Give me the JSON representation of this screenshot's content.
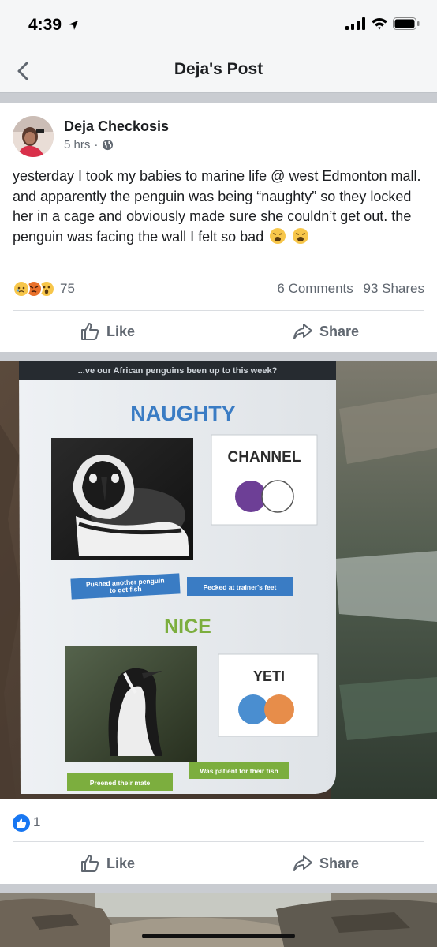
{
  "status_bar": {
    "time": "4:39"
  },
  "nav": {
    "title": "Deja's Post"
  },
  "post": {
    "author": "Deja Checkosis",
    "time": "5 hrs",
    "text": "yesterday I took my babies to marine life @ west Edmonton mall. and apparently the penguin was being “naughty” so they locked her in a cage and obviously made sure she couldn’t get out. the penguin was facing the wall I felt so bad",
    "reaction_count": "75",
    "comments": "6 Comments",
    "shares": "93 Shares",
    "like_label": "Like",
    "share_label": "Share"
  },
  "photo": {
    "board_header": "...ve our African penguins been up to this week?",
    "naughty_heading": "NAUGHTY",
    "naughty_name": "CHANNEL",
    "naughty_tag_1": "Pushed another penguin to get fish",
    "naughty_tag_2": "Pecked at trainer's feet",
    "nice_heading": "NICE",
    "nice_name": "YETI",
    "nice_tag_1": "Preened their mate",
    "nice_tag_2": "Was patient for their fish",
    "like_count": "1",
    "like_label": "Like",
    "share_label": "Share"
  },
  "colors": {
    "facebook_blue": "#1877f2",
    "naughty_blue": "#3a7cc4",
    "nice_green": "#7cae3e"
  }
}
